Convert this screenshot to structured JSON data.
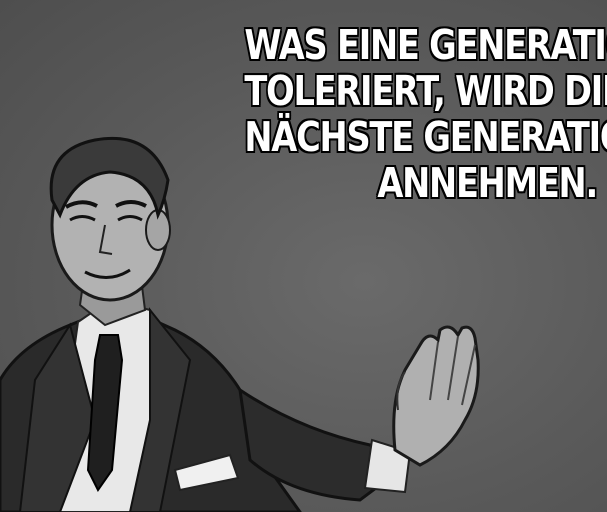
{
  "caption": {
    "lines": [
      "WAS EINE GENERATION",
      "TOLERIERT, WIRD DIE",
      "NÄCHSTE GENERATION",
      "ANNEHMEN."
    ]
  },
  "colors": {
    "background": "#5c5c5c",
    "caption_text": "#ffffff",
    "caption_outline": "#000000"
  }
}
